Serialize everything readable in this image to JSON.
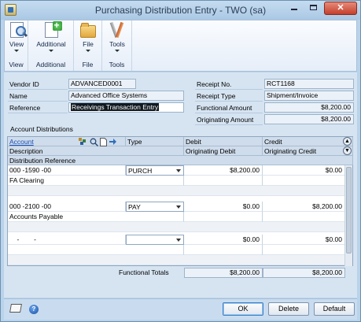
{
  "window": {
    "title": "Purchasing Distribution Entry  -  TWO (sa)",
    "minimize_glyph": "",
    "maximize_glyph": "",
    "close_glyph": "✕"
  },
  "ribbon": {
    "groups": [
      {
        "label": "View",
        "buttons": [
          {
            "label": "View",
            "icon": "view-icon"
          }
        ]
      },
      {
        "label": "Additional",
        "buttons": [
          {
            "label": "Additional",
            "icon": "additional-icon"
          }
        ]
      },
      {
        "label": "File",
        "buttons": [
          {
            "label": "File",
            "icon": "folder-icon"
          }
        ]
      },
      {
        "label": "Tools",
        "buttons": [
          {
            "label": "Tools",
            "icon": "tools-icon"
          }
        ]
      }
    ]
  },
  "header": {
    "vendor_id_label": "Vendor ID",
    "vendor_id": "ADVANCED0001",
    "name_label": "Name",
    "name": "Advanced Office Systems",
    "reference_label": "Reference",
    "reference": "Receivings Transaction Entry",
    "receipt_no_label": "Receipt No.",
    "receipt_no": "RCT1168",
    "receipt_type_label": "Receipt Type",
    "receipt_type": "Shipment/Invoice",
    "functional_amount_label": "Functional Amount",
    "functional_amount": "$8,200.00",
    "originating_amount_label": "Originating Amount",
    "originating_amount": "$8,200.00"
  },
  "distributions": {
    "section_label": "Account Distributions",
    "columns": {
      "account": "Account",
      "type": "Type",
      "debit": "Debit",
      "credit": "Credit",
      "description": "Description",
      "originating_debit": "Originating Debit",
      "originating_credit": "Originating Credit",
      "distribution_reference": "Distribution Reference"
    },
    "rows": [
      {
        "account": "000 -1590 -00",
        "type": "PURCH",
        "debit": "$8,200.00",
        "credit": "$0.00",
        "description": "FA Clearing"
      },
      {
        "account": "000 -2100 -00",
        "type": "PAY",
        "debit": "$0.00",
        "credit": "$8,200.00",
        "description": "Accounts Payable"
      },
      {
        "account": "    -        -",
        "type": "",
        "debit": "$0.00",
        "credit": "$0.00",
        "description": ""
      }
    ],
    "totals_label": "Functional Totals",
    "total_debit": "$8,200.00",
    "total_credit": "$8,200.00"
  },
  "footer": {
    "ok_label": "OK",
    "delete_label": "Delete",
    "default_label": "Default",
    "help_glyph": "?"
  }
}
